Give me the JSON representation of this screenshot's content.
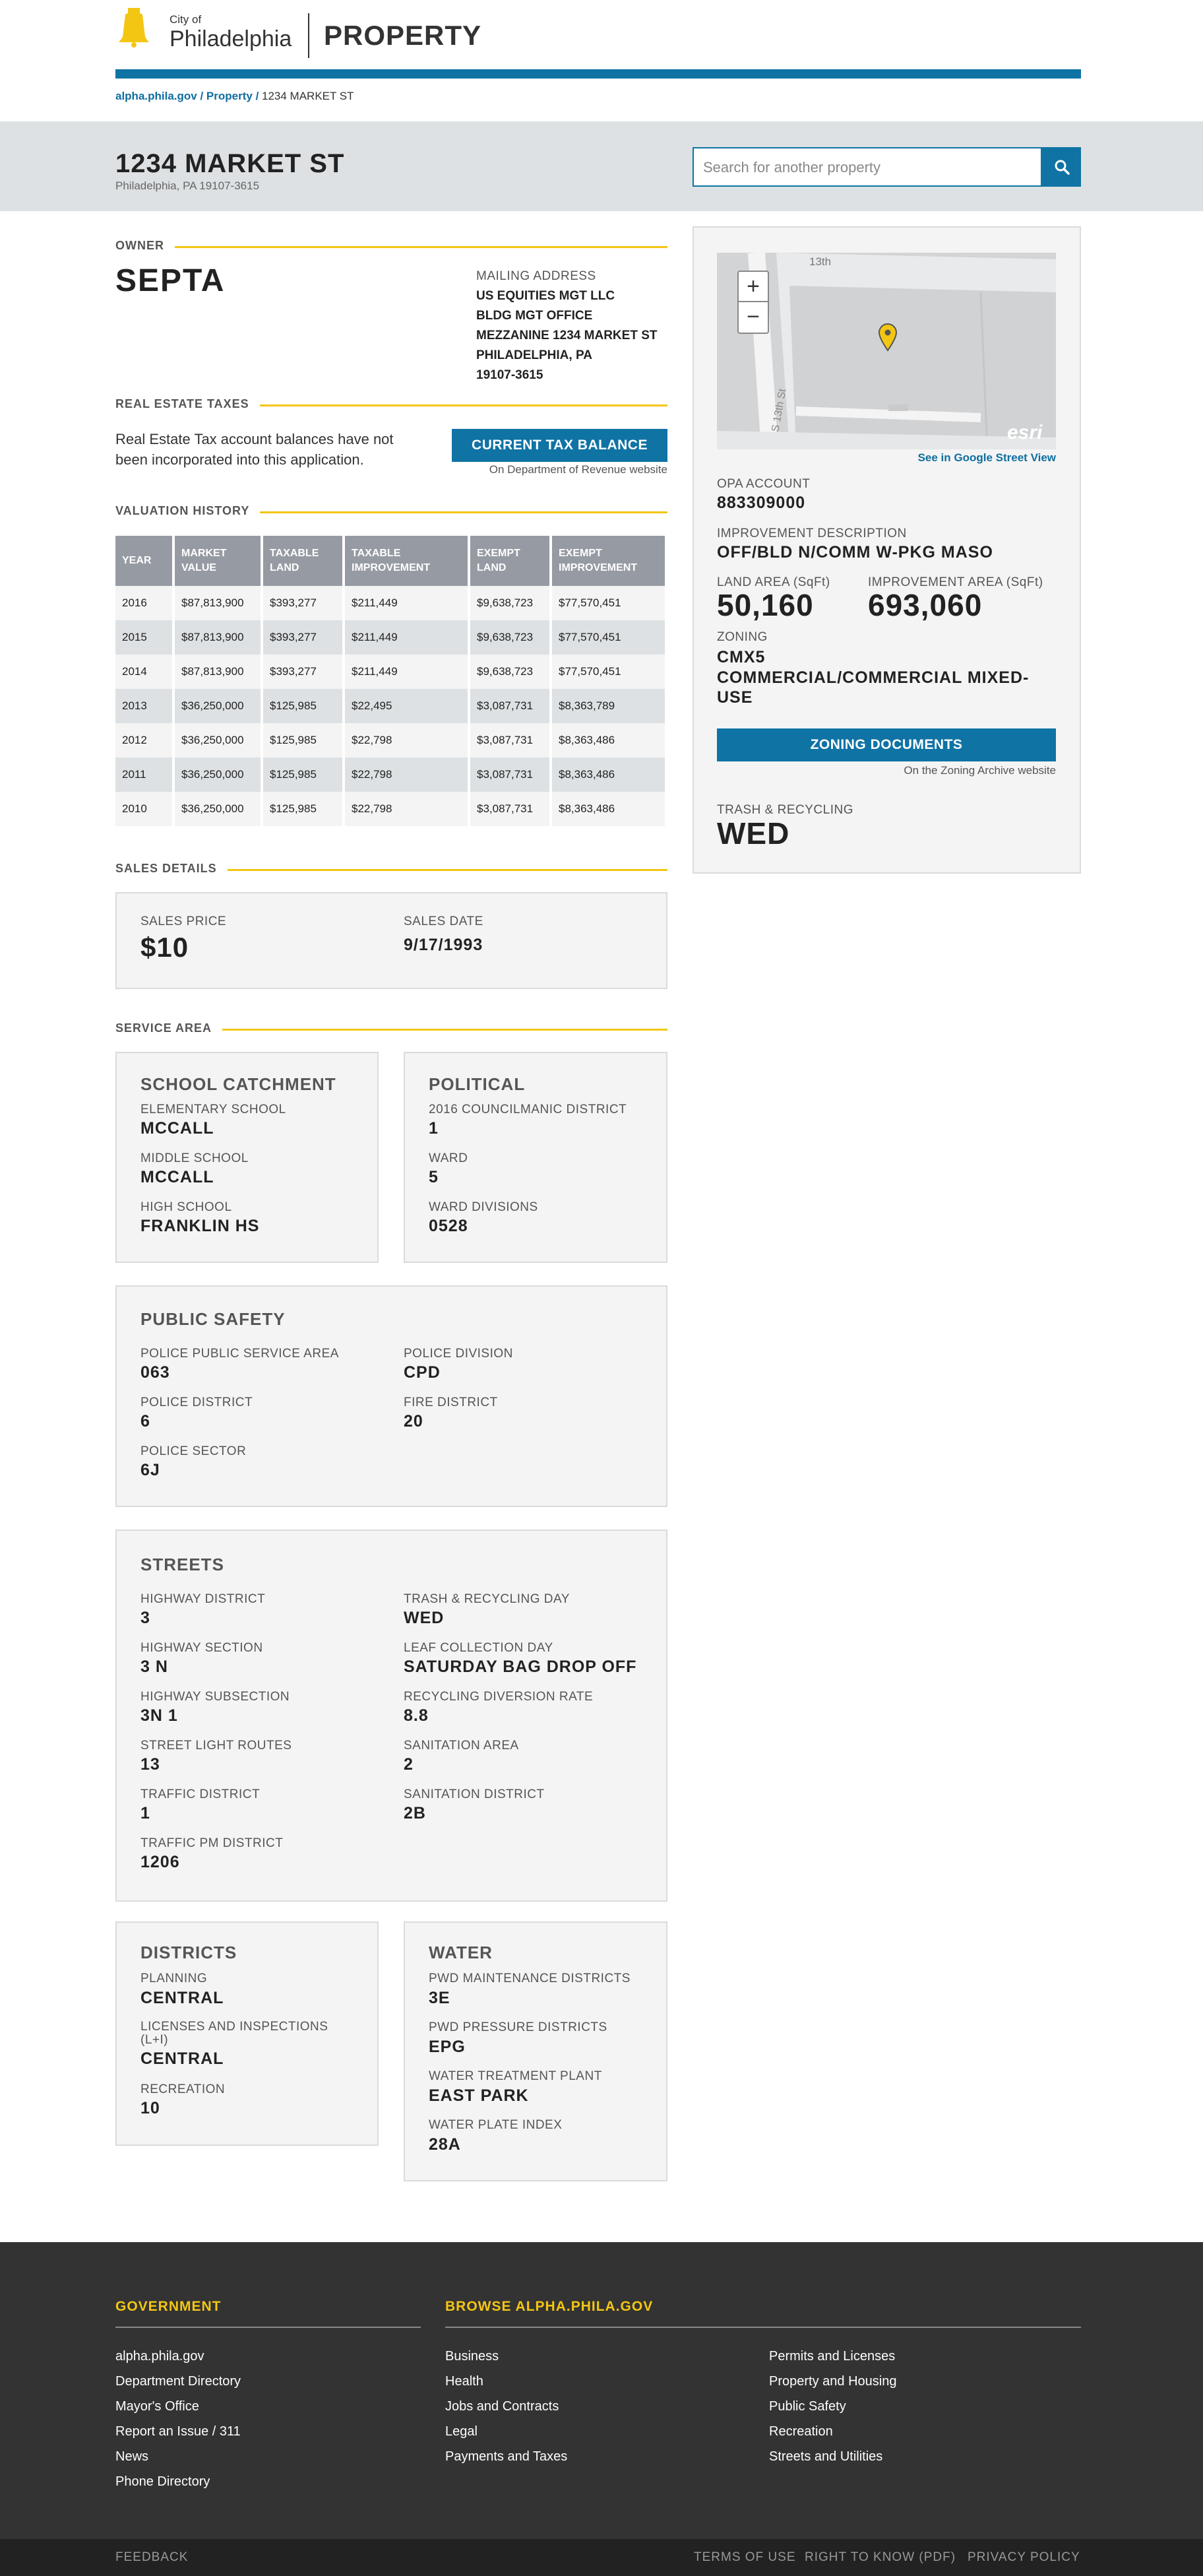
{
  "header": {
    "city_line1": "City of",
    "city_line2": "Philadelphia",
    "app_title": "PROPERTY"
  },
  "breadcrumb": {
    "home": "alpha.phila.gov",
    "sep1": " / ",
    "property": "Property",
    "sep2": " / ",
    "current": "1234 MARKET ST"
  },
  "hero": {
    "address": "1234 MARKET ST",
    "city_zip": "Philadelphia, PA 19107-3615",
    "search_placeholder": "Search for another property"
  },
  "owner": {
    "section_title": "OWNER",
    "name": "SEPTA",
    "mailing_label": "MAILING ADDRESS",
    "mailing_lines": [
      "US EQUITIES MGT LLC",
      "BLDG MGT OFFICE",
      "MEZZANINE 1234 MARKET ST",
      "PHILADELPHIA, PA",
      "19107-3615"
    ]
  },
  "taxes": {
    "section_title": "REAL ESTATE TAXES",
    "text": "Real Estate Tax account balances have not been incorporated into this application.",
    "button": "CURRENT TAX BALANCE",
    "note": "On Department of Revenue website"
  },
  "valuation": {
    "section_title": "VALUATION HISTORY",
    "headers": [
      "YEAR",
      "MARKET VALUE",
      "TAXABLE LAND",
      "TAXABLE IMPROVEMENT",
      "EXEMPT LAND",
      "EXEMPT IMPROVEMENT"
    ],
    "rows": [
      [
        "2016",
        "$87,813,900",
        "$393,277",
        "$211,449",
        "$9,638,723",
        "$77,570,451"
      ],
      [
        "2015",
        "$87,813,900",
        "$393,277",
        "$211,449",
        "$9,638,723",
        "$77,570,451"
      ],
      [
        "2014",
        "$87,813,900",
        "$393,277",
        "$211,449",
        "$9,638,723",
        "$77,570,451"
      ],
      [
        "2013",
        "$36,250,000",
        "$125,985",
        "$22,495",
        "$3,087,731",
        "$8,363,789"
      ],
      [
        "2012",
        "$36,250,000",
        "$125,985",
        "$22,798",
        "$3,087,731",
        "$8,363,486"
      ],
      [
        "2011",
        "$36,250,000",
        "$125,985",
        "$22,798",
        "$3,087,731",
        "$8,363,486"
      ],
      [
        "2010",
        "$36,250,000",
        "$125,985",
        "$22,798",
        "$3,087,731",
        "$8,363,486"
      ]
    ]
  },
  "sales": {
    "section_title": "SALES DETAILS",
    "price_label": "SALES PRICE",
    "price": "$10",
    "date_label": "SALES DATE",
    "date": "9/17/1993"
  },
  "service": {
    "section_title": "SERVICE AREA",
    "school": {
      "title": "SCHOOL CATCHMENT",
      "elem_label": "ELEMENTARY SCHOOL",
      "elem": "MCCALL",
      "middle_label": "MIDDLE SCHOOL",
      "middle": "MCCALL",
      "high_label": "HIGH SCHOOL",
      "high": "FRANKLIN HS"
    },
    "political": {
      "title": "POLITICAL",
      "council_label": "2016 COUNCILMANIC DISTRICT",
      "council": "1",
      "ward_label": "WARD",
      "ward": "5",
      "div_label": "WARD DIVISIONS",
      "div": "0528"
    },
    "safety": {
      "title": "PUBLIC SAFETY",
      "psa_label": "POLICE PUBLIC SERVICE AREA",
      "psa": "063",
      "division_label": "POLICE DIVISION",
      "division": "CPD",
      "district_label": "POLICE DISTRICT",
      "district": "6",
      "fire_label": "FIRE DISTRICT",
      "fire": "20",
      "sector_label": "POLICE SECTOR",
      "sector": "6J"
    },
    "streets": {
      "title": "STREETS",
      "hwy_district_label": "HIGHWAY DISTRICT",
      "hwy_district": "3",
      "trash_day_label": "TRASH & RECYCLING DAY",
      "trash_day": "WED",
      "hwy_section_label": "HIGHWAY SECTION",
      "hwy_section": "3 N",
      "leaf_label": "LEAF COLLECTION DAY",
      "leaf": "SATURDAY BAG DROP OFF",
      "hwy_sub_label": "HIGHWAY SUBSECTION",
      "hwy_sub": "3N 1",
      "recycle_label": "RECYCLING DIVERSION RATE",
      "recycle": "8.8",
      "light_label": "STREET LIGHT ROUTES",
      "light": "13",
      "san_area_label": "SANITATION AREA",
      "san_area": "2",
      "traffic_label": "TRAFFIC DISTRICT",
      "traffic": "1",
      "san_district_label": "SANITATION DISTRICT",
      "san_district": "2B",
      "traffic_pm_label": "TRAFFIC PM DISTRICT",
      "traffic_pm": "1206"
    },
    "districts": {
      "title": "DISTRICTS",
      "planning_label": "PLANNING",
      "planning": "CENTRAL",
      "li_label": "LICENSES AND INSPECTIONS (L+I)",
      "li": "CENTRAL",
      "rec_label": "RECREATION",
      "rec": "10"
    },
    "water": {
      "title": "WATER",
      "pwd_maint_label": "PWD MAINTENANCE DISTRICTS",
      "pwd_maint": "3E",
      "pwd_press_label": "PWD PRESSURE DISTRICTS",
      "pwd_press": "EPG",
      "plant_label": "WATER TREATMENT PLANT",
      "plant": "EAST PARK",
      "plate_label": "WATER PLATE INDEX",
      "plate": "28A"
    }
  },
  "sidebar": {
    "map_street_label": "13th",
    "map_street_label2": "S 13th St",
    "map_watermark": "esri",
    "street_view": "See in Google Street View",
    "opa_label": "OPA ACCOUNT",
    "opa": "883309000",
    "impr_desc_label": "IMPROVEMENT DESCRIPTION",
    "impr_desc": "OFF/BLD N/COMM W-PKG MASO",
    "land_area_label": "LAND AREA (SqFt)",
    "land_area": "50,160",
    "impr_area_label": "IMPROVEMENT AREA (SqFt)",
    "impr_area": "693,060",
    "zoning_label": "ZONING",
    "zoning_code": "CMX5",
    "zoning_desc": "COMMERCIAL/COMMERCIAL MIXED-USE",
    "zoning_button": "ZONING DOCUMENTS",
    "zoning_note": "On the Zoning Archive website",
    "trash_label": "TRASH & RECYCLING",
    "trash": "WED",
    "map_zoom_in": "+",
    "map_zoom_out": "−"
  },
  "footer": {
    "gov_title": "GOVERNMENT",
    "browse_title": "BROWSE ALPHA.PHILA.GOV",
    "gov_links": [
      "alpha.phila.gov",
      "Department Directory",
      "Mayor's Office",
      "Report an Issue / 311",
      "News",
      "Phone Directory"
    ],
    "browse_col1": [
      "Business",
      "Health",
      "Jobs and Contracts",
      "Legal",
      "Payments and Taxes"
    ],
    "browse_col2": [
      "Permits and Licenses",
      "Property and Housing",
      "Public Safety",
      "Recreation",
      "Streets and Utilities"
    ],
    "feedback": "FEEDBACK",
    "terms": "TERMS OF USE",
    "right_to_know": "RIGHT TO KNOW (PDF)",
    "privacy": "PRIVACY POLICY"
  },
  "colors": {
    "brand_blue": "#0f73a4",
    "accent_yellow": "#f3c613",
    "footer_bg": "#333333"
  }
}
